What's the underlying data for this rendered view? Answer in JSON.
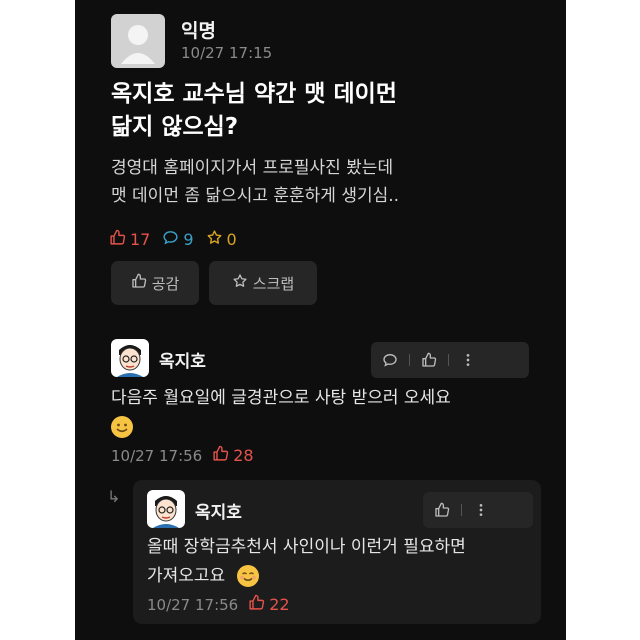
{
  "post": {
    "author": "익명",
    "time": "10/27 17:15",
    "title_line1": "옥지호 교수님 약간 맷 데이먼",
    "title_line2": "닮지 않으심?",
    "body_line1": "경영대 홈페이지가서 프로필사진 봤는데",
    "body_line2": "맷 데이먼 좀 닮으시고 훈훈하게 생기심..",
    "likes": "17",
    "comments": "9",
    "scraps": "0",
    "like_button_label": "공감",
    "scrap_button_label": "스크랩"
  },
  "comment": {
    "author": "옥지호",
    "text": "다음주 월요일에 글경관으로 사탕 받으러 오세요",
    "time": "10/27 17:56",
    "likes": "28"
  },
  "reply": {
    "author": "옥지호",
    "text_line1": "올때 장학금추천서 사인이나 이런거 필요하면",
    "text_line2": "가져오고요",
    "time": "10/27 17:56",
    "likes": "22"
  },
  "colors": {
    "background": "#0e0e0e",
    "like": "#e5534b",
    "comment": "#3aa0c8",
    "scrap": "#d8a520"
  },
  "icons": [
    "thumbs-up-icon",
    "speech-bubble-icon",
    "star-icon",
    "more-vertical-icon",
    "reply-arrow-icon",
    "smile-emoji-icon"
  ]
}
